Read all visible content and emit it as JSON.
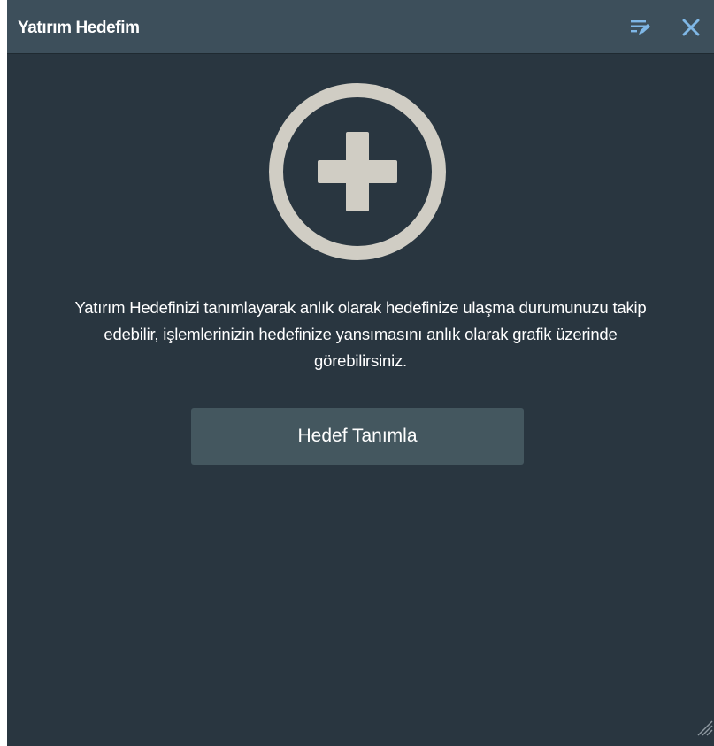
{
  "window": {
    "title": "Yatırım Hedefim",
    "edit_icon": "edit-list-icon",
    "close_icon": "close-icon"
  },
  "empty_state": {
    "icon": "add-circle-icon",
    "message": "Yatırım Hedefinizi tanımlayarak anlık olarak hedefinize ulaşma durumunuzu takip edebilir, işlemlerinizin hedefinize yansımasını anlık olarak grafik üzerinde görebilirsiniz.",
    "button_label": "Hedef Tanımla"
  },
  "colors": {
    "panel_background": "#293640",
    "title_bar": "#3d4f5b",
    "icon_accent": "#7fb7e6",
    "circle_icon": "#d0cdc4",
    "button_background": "#44575f",
    "text": "#ffffff"
  }
}
